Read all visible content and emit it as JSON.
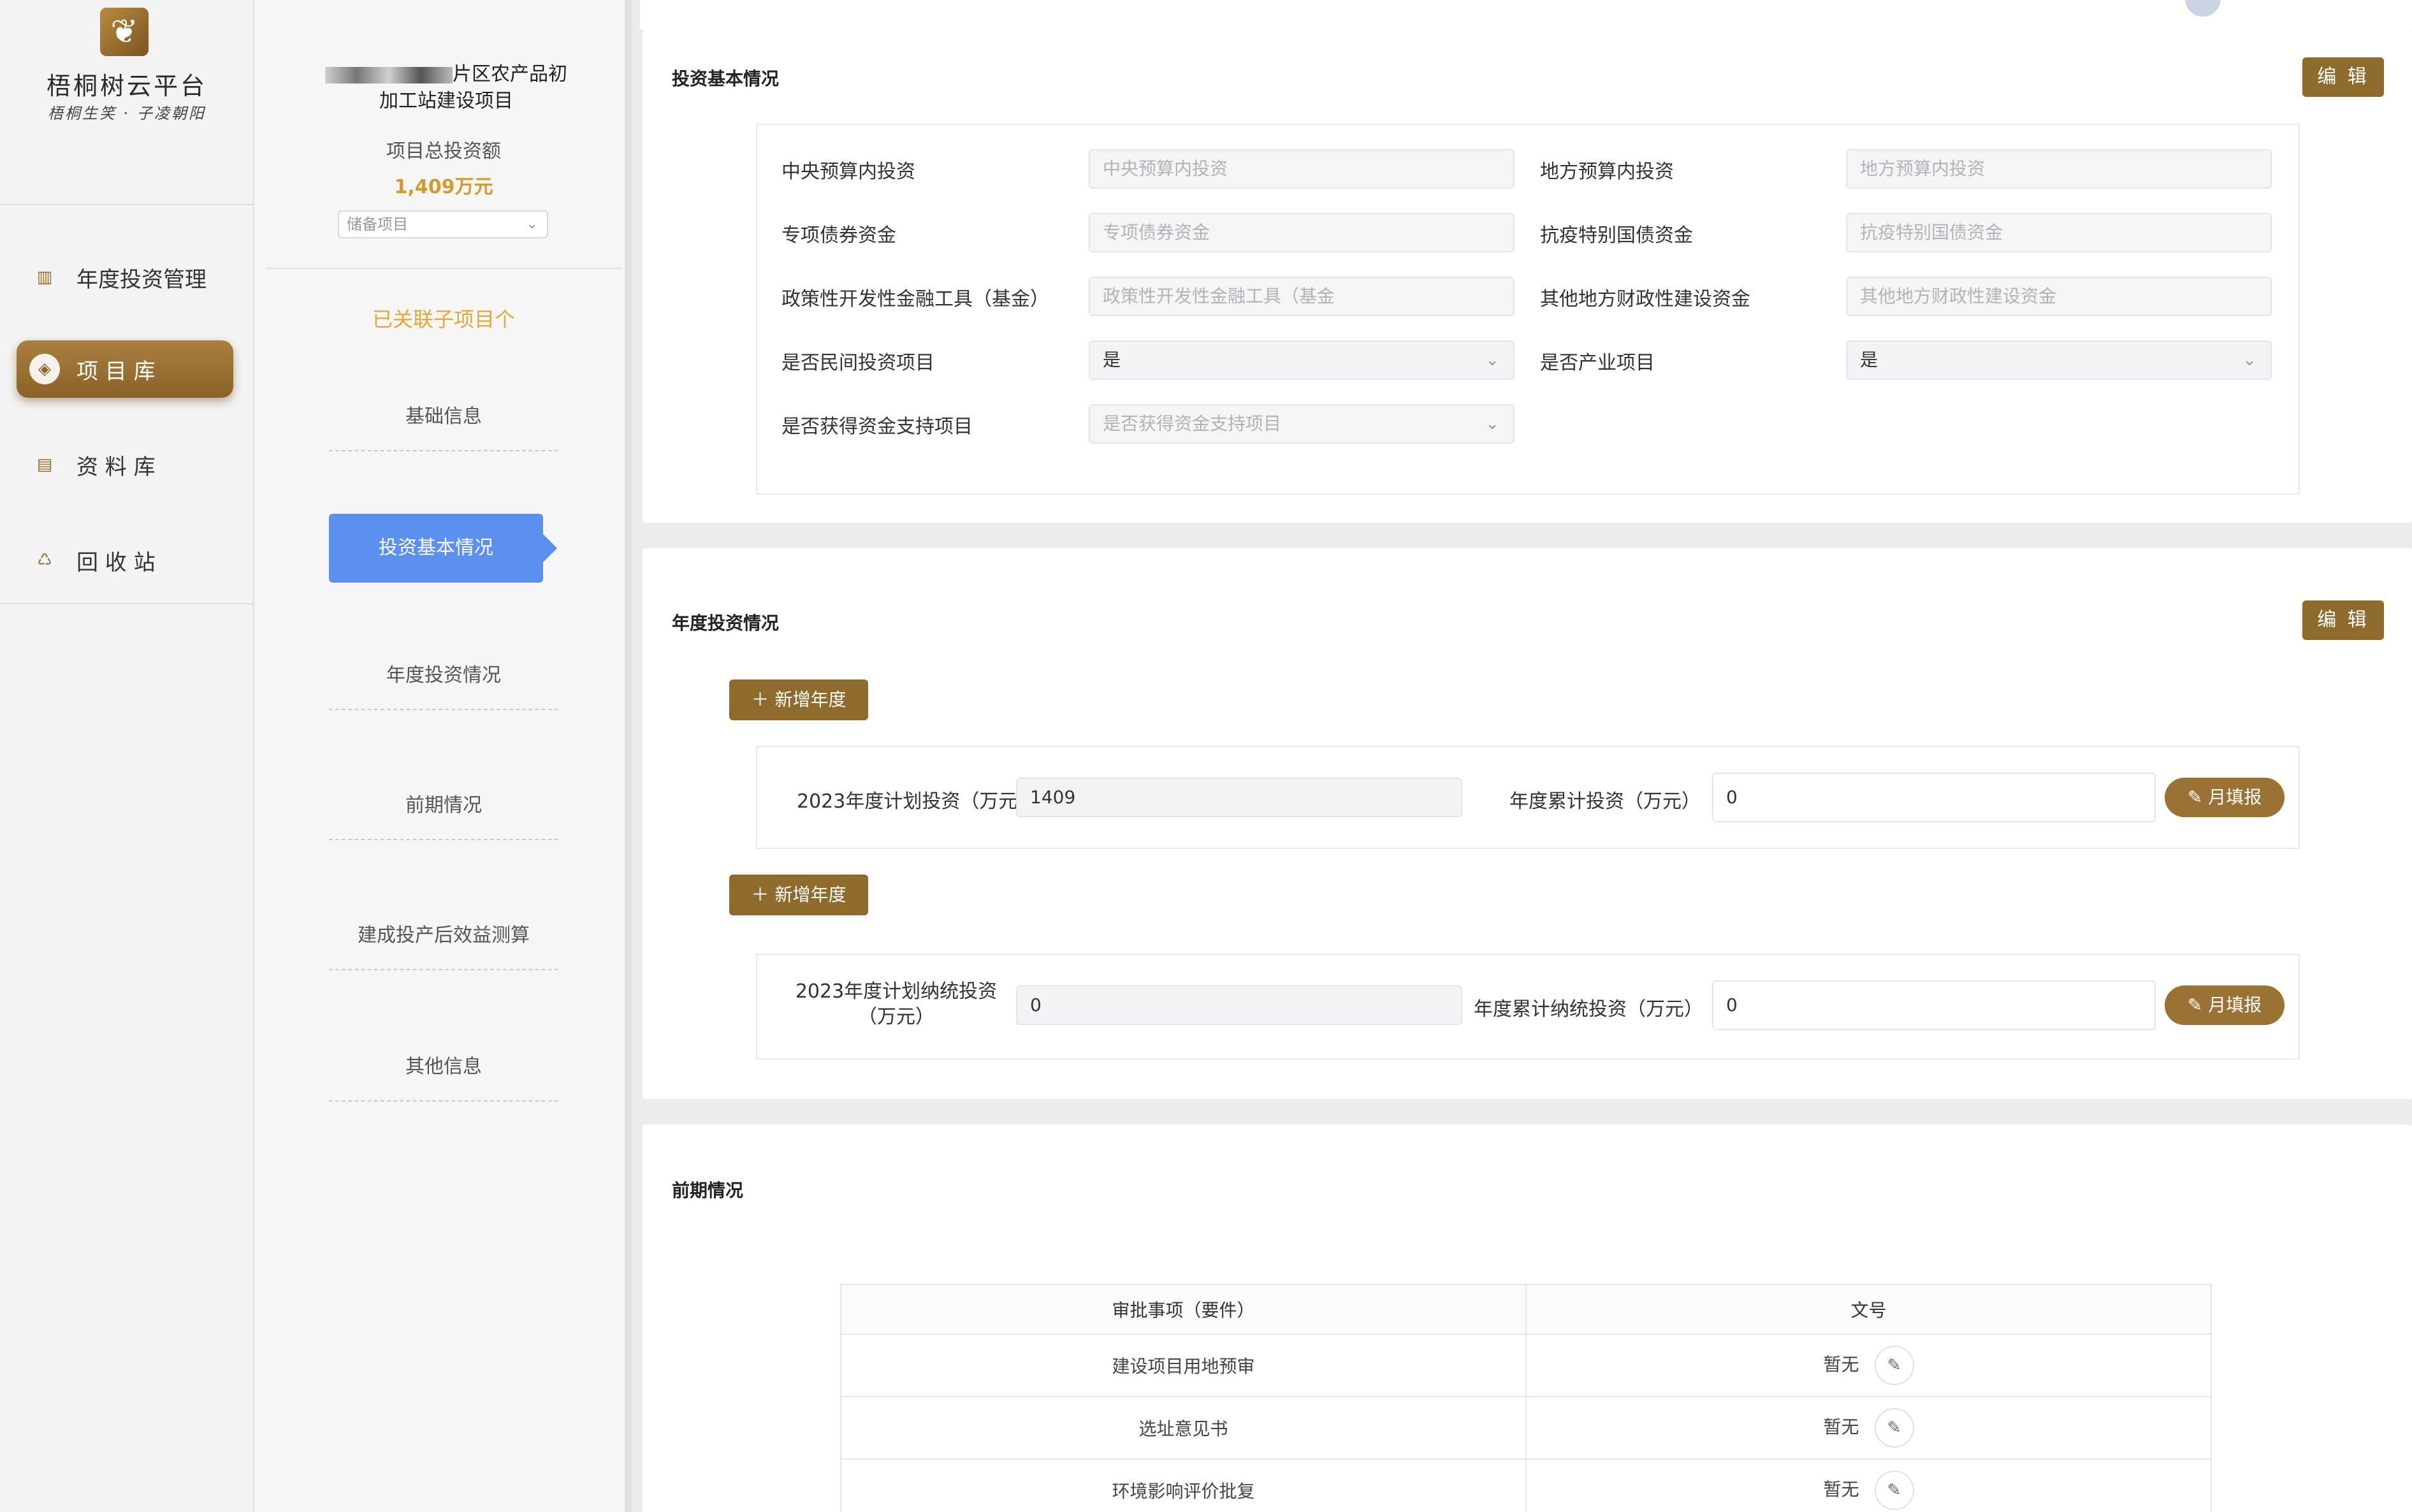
{
  "brand": {
    "name": "梧桐树云平台",
    "slogan": "梧桐生笑 · 子凌朝阳"
  },
  "nav": [
    {
      "label": "年度投资管理",
      "icon": "chart-icon"
    },
    {
      "label": "项 目 库",
      "icon": "layers-icon"
    },
    {
      "label": "资 料 库",
      "icon": "document-icon"
    },
    {
      "label": "回 收 站",
      "icon": "trash-icon"
    }
  ],
  "project": {
    "title_line1": "片区农产品初",
    "title_line2": "加工站建设项目",
    "invest_label": "项目总投资额",
    "invest_value": "1,409万元",
    "status_placeholder": "储备项目",
    "linked_text": "已关联子项目个"
  },
  "subnav": [
    "基础信息",
    "投资基本情况",
    "年度投资情况",
    "前期情况",
    "建成投产后效益测算",
    "其他信息"
  ],
  "invest_basic": {
    "title": "投资基本情况",
    "edit_label": "编 辑",
    "fields": [
      {
        "label": "中央预算内投资",
        "placeholder": "中央预算内投资"
      },
      {
        "label": "地方预算内投资",
        "placeholder": "地方预算内投资"
      },
      {
        "label": "专项债券资金",
        "placeholder": "专项债券资金"
      },
      {
        "label": "抗疫特别国债资金",
        "placeholder": "抗疫特别国债资金"
      },
      {
        "label": "政策性开发性金融工具（基金）",
        "placeholder": "政策性开发性金融工具（基金"
      },
      {
        "label": "其他地方财政性建设资金",
        "placeholder": "其他地方财政性建设资金"
      },
      {
        "label": "是否民间投资项目",
        "value": "是"
      },
      {
        "label": "是否产业项目",
        "value": "是"
      },
      {
        "label": "是否获得资金支持项目",
        "placeholder": "是否获得资金支持项目"
      }
    ]
  },
  "annual": {
    "title": "年度投资情况",
    "edit_label": "编 辑",
    "add_year": "＋ 新增年度",
    "rows": [
      {
        "label_left": "2023年度计划投资（万元）",
        "value_left": "1409",
        "label_right": "年度累计投资（万元）",
        "value_right": "0",
        "btn": "月填报"
      },
      {
        "label_left": "2023年度计划纳统投资（万元）",
        "value_left": "0",
        "label_right": "年度累计纳统投资（万元）",
        "value_right": "0",
        "btn": "月填报"
      }
    ]
  },
  "preliminary": {
    "title": "前期情况",
    "columns": [
      "审批事项（要件）",
      "文号"
    ],
    "rows": [
      {
        "item": "建设项目用地预审",
        "doc": "暂无"
      },
      {
        "item": "选址意见书",
        "doc": "暂无"
      },
      {
        "item": "环境影响评价批复",
        "doc": "暂无"
      }
    ]
  }
}
